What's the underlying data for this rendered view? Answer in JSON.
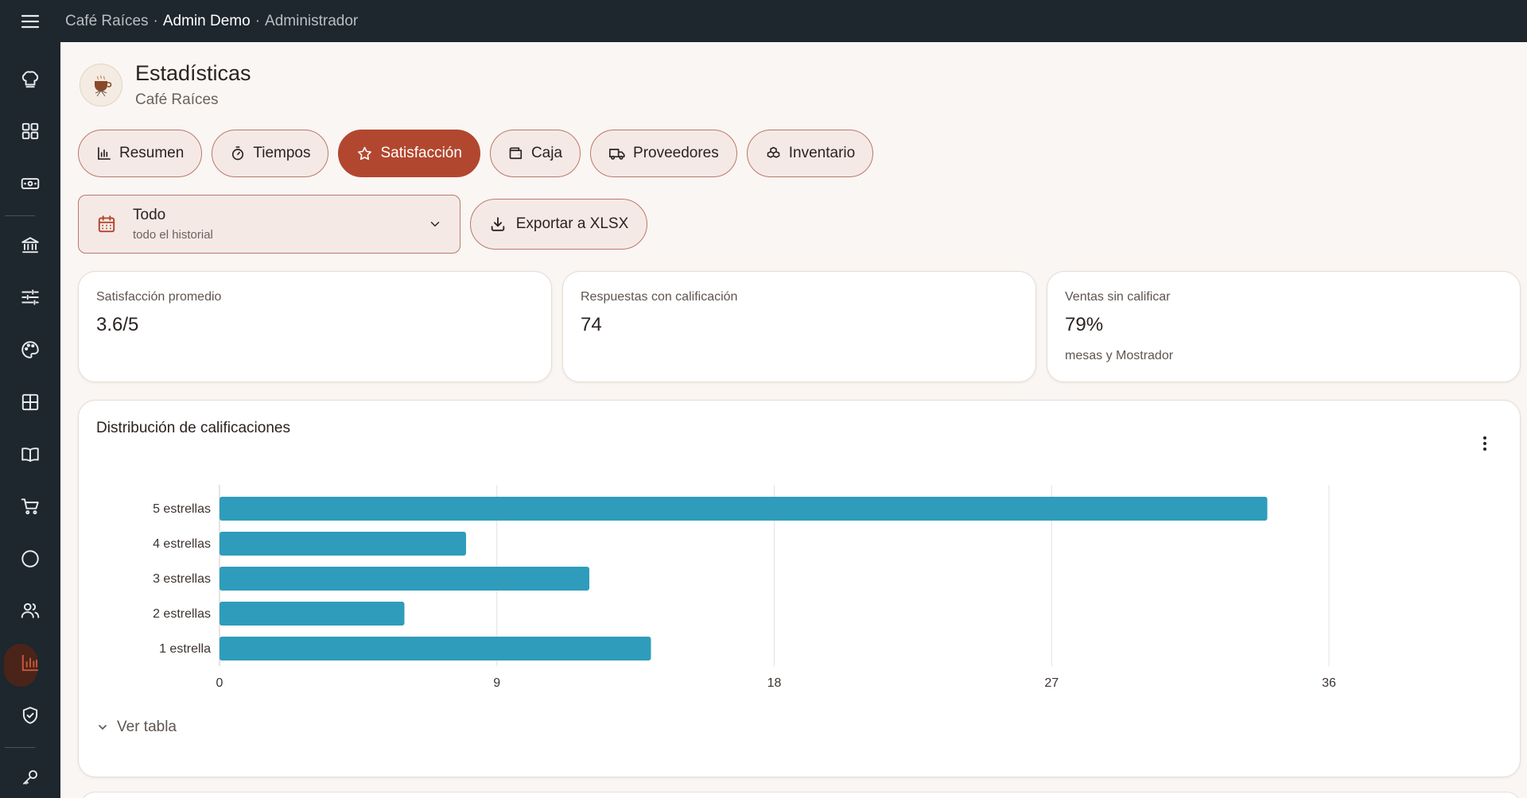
{
  "topbar": {
    "app": "Café Raíces",
    "user": "Admin Demo",
    "role": "Administrador",
    "separator": "·"
  },
  "sidebar": {
    "items": [
      {
        "icon": "chef-hat-icon"
      },
      {
        "icon": "dashboard-grid-icon"
      },
      {
        "icon": "cash-icon"
      },
      {
        "icon": "bank-icon"
      },
      {
        "icon": "sliders-icon"
      },
      {
        "icon": "palette-icon"
      },
      {
        "icon": "table-grid-icon"
      },
      {
        "icon": "book-icon"
      },
      {
        "icon": "cart-icon"
      },
      {
        "icon": "circle-icon"
      },
      {
        "icon": "users-icon"
      },
      {
        "icon": "bar-chart-icon",
        "active": true
      },
      {
        "icon": "shield-check-icon"
      },
      {
        "icon": "key-icon"
      }
    ]
  },
  "header": {
    "title": "Estadísticas",
    "subtitle": "Café Raíces"
  },
  "tabs": [
    {
      "label": "Resumen",
      "icon": "bar-chart-icon"
    },
    {
      "label": "Tiempos",
      "icon": "stopwatch-icon"
    },
    {
      "label": "Satisfacción",
      "icon": "star-icon",
      "active": true
    },
    {
      "label": "Caja",
      "icon": "wallet-icon"
    },
    {
      "label": "Proveedores",
      "icon": "truck-icon"
    },
    {
      "label": "Inventario",
      "icon": "boxes-icon"
    }
  ],
  "filter": {
    "period": "Todo",
    "period_desc": "todo el historial",
    "export_label": "Exportar a XLSX"
  },
  "kpis": [
    {
      "label": "Satisfacción promedio",
      "value": "3.6/5",
      "note": ""
    },
    {
      "label": "Respuestas con calificación",
      "value": "74",
      "note": ""
    },
    {
      "label": "Ventas sin calificar",
      "value": "79%",
      "note": "mesas y Mostrador"
    }
  ],
  "chart_card": {
    "title": "Distribución de calificaciones",
    "toggle_label": "Ver tabla"
  },
  "chart_data": {
    "type": "bar",
    "orientation": "horizontal",
    "title": "Distribución de calificaciones",
    "xlabel": "",
    "ylabel": "",
    "categories": [
      "5 estrellas",
      "4 estrellas",
      "3 estrellas",
      "2 estrellas",
      "1 estrella"
    ],
    "values": [
      34,
      8,
      12,
      6,
      14
    ],
    "xlim": [
      0,
      36
    ],
    "xticks": [
      0,
      9,
      18,
      27,
      36
    ],
    "grid": true,
    "color": "#2f9cbb"
  },
  "colors": {
    "accent": "#b2472f",
    "topbar": "#1e262e",
    "bar": "#2f9cbb"
  }
}
